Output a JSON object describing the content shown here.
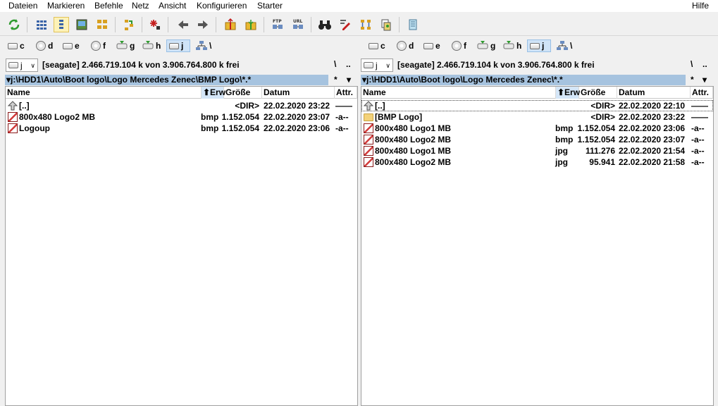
{
  "menu": [
    "Dateien",
    "Markieren",
    "Befehle",
    "Netz",
    "Ansicht",
    "Konfigurieren",
    "Starter"
  ],
  "menu_help": "Hilfe",
  "drives": [
    {
      "letter": "c",
      "kind": "disk"
    },
    {
      "letter": "d",
      "kind": "cd"
    },
    {
      "letter": "e",
      "kind": "disk"
    },
    {
      "letter": "f",
      "kind": "cd"
    },
    {
      "letter": "g",
      "kind": "net"
    },
    {
      "letter": "h",
      "kind": "net"
    },
    {
      "letter": "j",
      "kind": "disk",
      "active": true
    },
    {
      "letter": "\\",
      "kind": "network"
    }
  ],
  "left": {
    "drive_value": "j",
    "drive_info": "[seagate]  2.466.719.104 k von 3.906.764.800 k frei",
    "path": "▾j:\\HDD1\\Auto\\Boot logo\\Logo Mercedes Zenec\\BMP Logo\\*.*",
    "headers": {
      "name": "Name",
      "ext": "⬆Erw",
      "size": "Größe",
      "date": "Datum",
      "attr": "Attr."
    },
    "rows": [
      {
        "icon": "up",
        "name": "[..]",
        "ext": "",
        "size": "<DIR>",
        "date": "22.02.2020 23:22",
        "attr": "——"
      },
      {
        "icon": "bmp",
        "name": "800x480 Logo2 MB",
        "ext": "bmp",
        "size": "1.152.054",
        "date": "22.02.2020 23:07",
        "attr": "-a--"
      },
      {
        "icon": "bmp",
        "name": "Logoup",
        "ext": "bmp",
        "size": "1.152.054",
        "date": "22.02.2020 23:06",
        "attr": "-a--"
      }
    ]
  },
  "right": {
    "drive_value": "j",
    "drive_info": "[seagate]  2.466.719.104 k von 3.906.764.800 k frei",
    "path": "▾j:\\HDD1\\Auto\\Boot logo\\Logo Mercedes Zenec\\*.*",
    "headers": {
      "name": "Name",
      "ext": "⬆Erw",
      "size": "Größe",
      "date": "Datum",
      "attr": "Attr."
    },
    "rows": [
      {
        "icon": "up",
        "name": "[..]",
        "ext": "",
        "size": "<DIR>",
        "date": "22.02.2020 22:10",
        "attr": "——",
        "cursor": true
      },
      {
        "icon": "folder",
        "name": "[BMP Logo]",
        "ext": "",
        "size": "<DIR>",
        "date": "22.02.2020 23:22",
        "attr": "——"
      },
      {
        "icon": "bmp",
        "name": "800x480 Logo1 MB",
        "ext": "bmp",
        "size": "1.152.054",
        "date": "22.02.2020 23:06",
        "attr": "-a--"
      },
      {
        "icon": "bmp",
        "name": "800x480 Logo2 MB",
        "ext": "bmp",
        "size": "1.152.054",
        "date": "22.02.2020 23:07",
        "attr": "-a--"
      },
      {
        "icon": "bmp",
        "name": "800x480 Logo1 MB",
        "ext": "jpg",
        "size": "111.276",
        "date": "22.02.2020 21:54",
        "attr": "-a--"
      },
      {
        "icon": "bmp",
        "name": "800x480 Logo2 MB",
        "ext": "jpg",
        "size": "95.941",
        "date": "22.02.2020 21:58",
        "attr": "-a--"
      }
    ]
  },
  "path_tools": {
    "root": "\\",
    "parent": "..",
    "star": "*",
    "down": "▾"
  }
}
